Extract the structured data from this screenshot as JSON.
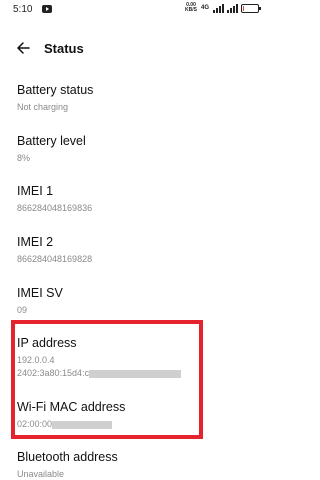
{
  "status_bar": {
    "time": "5:10",
    "speed_top": "0.00",
    "speed_bottom": "KB/S",
    "network": "4G",
    "battery_level": 0.08
  },
  "header": {
    "title": "Status"
  },
  "items": [
    {
      "title": "Battery status",
      "value": "Not charging"
    },
    {
      "title": "Battery level",
      "value": "8%"
    },
    {
      "title": "IMEI 1",
      "value": "866284048169836"
    },
    {
      "title": "IMEI 2",
      "value": "866284048169828"
    },
    {
      "title": "IMEI SV",
      "value": "09"
    },
    {
      "title": "IP address",
      "value": "192.0.0.4",
      "value2": "2402:3a80:15d4:c"
    },
    {
      "title": "Wi-Fi MAC address",
      "value": "02:00:00"
    },
    {
      "title": "Bluetooth address",
      "value": "Unavailable"
    }
  ],
  "colors": {
    "highlight_border": "#e4232c",
    "subtext": "#8a8a8a",
    "battery_low": "#e5484d"
  }
}
